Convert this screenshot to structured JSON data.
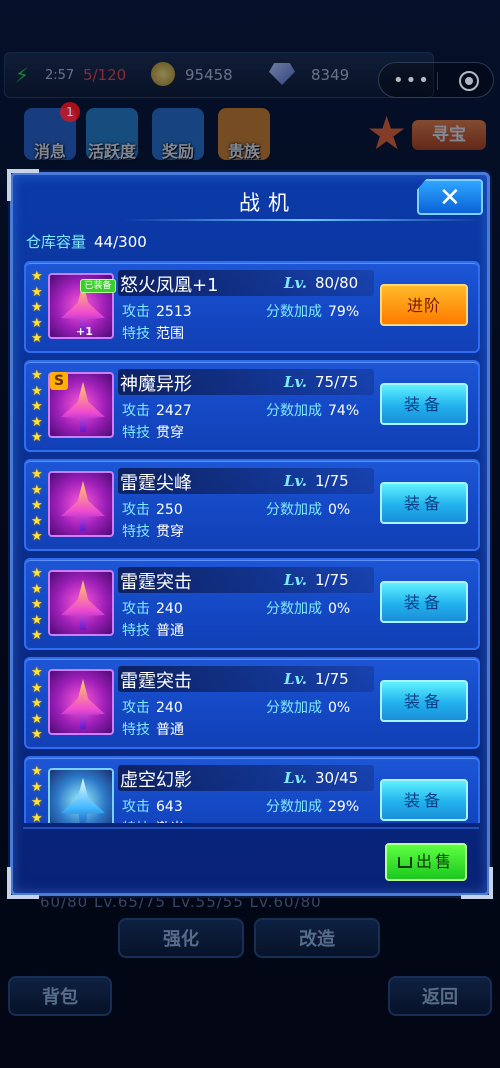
{
  "topbar": {
    "energy_time": "2:57",
    "energy_count": "5/120",
    "gold": "95458",
    "gems": "8349"
  },
  "capsule": {
    "more": "•••"
  },
  "menu": {
    "items": [
      {
        "label": "消息",
        "color": "#2a6bd8"
      },
      {
        "label": "活跃度",
        "color": "#2a8bd8"
      },
      {
        "label": "奖励",
        "color": "#2a7ad8"
      },
      {
        "label": "贵族",
        "color": "#e88a20"
      }
    ],
    "badge": "1",
    "treasure": "寻宝"
  },
  "panel": {
    "title": "战机",
    "close": "✕",
    "capacity_label": "仓库容量",
    "capacity_value": "44/300",
    "sell_label": "出售"
  },
  "labels": {
    "lv": "Lv.",
    "attack": "攻击",
    "bonus": "分数加成",
    "skill": "特技"
  },
  "planes": [
    {
      "name": "怒火凤凰+1",
      "level": "80/80",
      "attack": "2513",
      "bonus": "79%",
      "skill": "范围",
      "stars": 5,
      "action": "进阶",
      "equipped_tag": "已装备",
      "plus_tag": "+1"
    },
    {
      "name": "神魔异形",
      "level": "75/75",
      "attack": "2427",
      "bonus": "74%",
      "skill": "贯穿",
      "stars": 5,
      "action": "装备",
      "s_tag": "S"
    },
    {
      "name": "雷霆尖峰",
      "level": "1/75",
      "attack": "250",
      "bonus": "0%",
      "skill": "贯穿",
      "stars": 5,
      "action": "装备"
    },
    {
      "name": "雷霆突击",
      "level": "1/75",
      "attack": "240",
      "bonus": "0%",
      "skill": "普通",
      "stars": 5,
      "action": "装备"
    },
    {
      "name": "雷霆突击",
      "level": "1/75",
      "attack": "240",
      "bonus": "0%",
      "skill": "普通",
      "stars": 5,
      "action": "装备"
    },
    {
      "name": "虚空幻影",
      "level": "30/45",
      "attack": "643",
      "bonus": "29%",
      "skill": "激光",
      "stars": 4,
      "action": "装备"
    }
  ],
  "bottom": {
    "strengthen": "强化",
    "modify": "改造",
    "backpack": "背包",
    "back": "返回",
    "strip": "60/80    Lv.65/75    Lv.55/55    Lv.60/80"
  }
}
